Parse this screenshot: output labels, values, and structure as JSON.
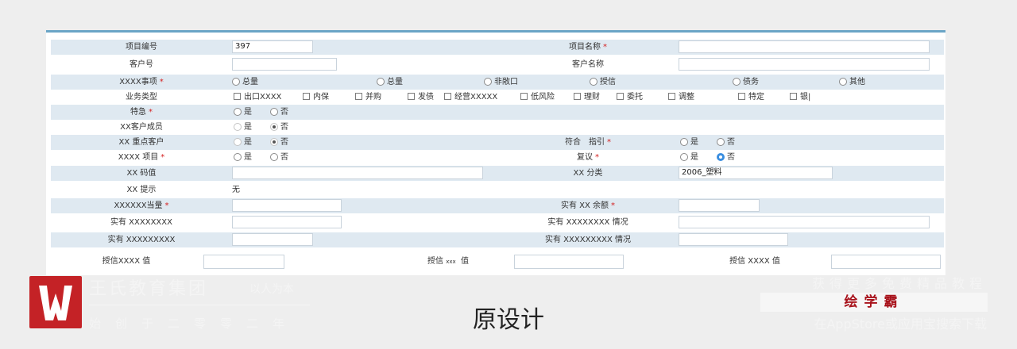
{
  "form": {
    "r1": {
      "l1": "项目编号",
      "v1": "397",
      "l2": "项目名称",
      "v2": ""
    },
    "r2": {
      "l1": "客户号",
      "v1": "",
      "l2": "客户名称",
      "v2": ""
    },
    "r3": {
      "label": "XXXX事项",
      "options": [
        "总量",
        "总量",
        "非敞口",
        "授信",
        "债务",
        "其他"
      ]
    },
    "r4": {
      "label": "业务类型",
      "options": [
        "出口XXXX",
        "内保",
        "并购",
        "发债",
        "经营XXXXX",
        "低风险",
        "理财",
        "委托",
        "调整",
        "特定",
        "银|"
      ]
    },
    "r5": {
      "label": "特急",
      "yes": "是",
      "no": "否"
    },
    "r6": {
      "label": "XX客户成员",
      "yes": "是",
      "no": "否"
    },
    "r7": {
      "label": "XX 重点客户",
      "yes": "是",
      "no": "否",
      "label2": "符合　指引",
      "yes2": "是",
      "no2": "否"
    },
    "r8": {
      "label": "XXXX 项目",
      "yes": "是",
      "no": "否",
      "label2": "复议",
      "yes2": "是",
      "no2": "否"
    },
    "r9": {
      "l1": "XX 码值",
      "v1": "",
      "l2": "XX 分类",
      "v2": "2006_塑料"
    },
    "r10": {
      "label": "XX 提示",
      "value": "无"
    },
    "r11": {
      "l1": "XXXXXX当量",
      "v1": "",
      "l2": "实有 XX 余额",
      "v2": ""
    },
    "r12": {
      "l1": "实有 XXXXXXXX",
      "v1": "",
      "l2": "实有 XXXXXXXX 情况",
      "v2": ""
    },
    "r13": {
      "l1": "实有 XXXXXXXXX",
      "v1": "",
      "l2": "实有 XXXXXXXXX 情况",
      "v2": ""
    },
    "r14": {
      "l1": "授信XXXX 值",
      "l2a": "授信",
      "l2b": "xxx",
      "l2c": "值",
      "l3": "授信 XXXX 值"
    }
  },
  "required_mark": "*",
  "footer": {
    "org_name": "王氏教育集团",
    "org_slogan": "以人为本",
    "org_since": "始创于二零零二年",
    "caption": "原设计",
    "promo_line1": "获得更多免费精品教程",
    "promo_app": "绘学霸",
    "promo_line2": "在AppStore或应用宝搜索下载"
  },
  "colors": {
    "accent": "#6aa5c6",
    "row_shade": "#dfe9f1",
    "required": "#d42020",
    "logo_red": "#c42226",
    "promo_red": "#a8121b"
  },
  "icons": [
    "radio-icon",
    "checkbox-icon",
    "logo-icon"
  ]
}
